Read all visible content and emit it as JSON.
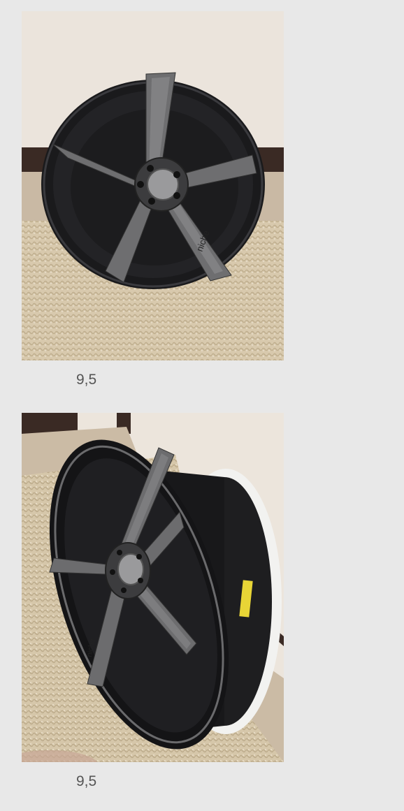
{
  "items": [
    {
      "caption": "9,5",
      "photo": "black-alloy-wheel-front-view"
    },
    {
      "caption": "9,5",
      "photo": "black-alloy-wheel-angled-view"
    }
  ],
  "colors": {
    "page_background": "#e8e8e8",
    "caption_text": "#555555"
  }
}
